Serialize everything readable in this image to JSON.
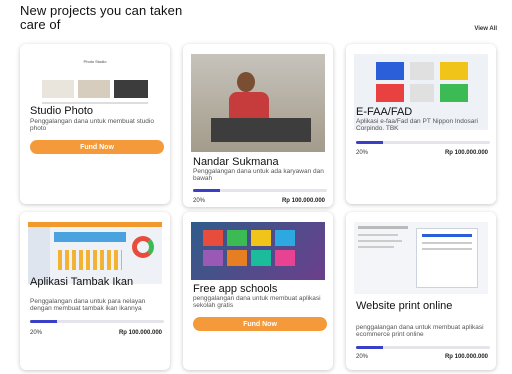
{
  "header": {
    "title": "New projects you can taken care of",
    "view_all": "View All"
  },
  "cards": [
    {
      "title": "Studio Photo",
      "desc": "Penggalangan dana untuk membuat studio photo",
      "button": "Fund Now",
      "thumb_label": "Photo Studio"
    },
    {
      "title": "Nandar Sukmana",
      "desc": "Penggalangan dana untuk ada karyawan dan bawah",
      "progress": 0.2,
      "percent": "20%",
      "amount": "Rp 100.000.000"
    },
    {
      "title": "E-FAA/FAD",
      "desc": "Aplikasi e-faa/Fad dan PT Nippon Indosari Corpindo. TBK",
      "progress": 0.2,
      "percent": "20%",
      "amount": "Rp 100.000.000"
    },
    {
      "title": "Aplikasi Tambak Ikan",
      "desc": "Penggalangan dana untuk para nelayan dengan membuat tambak ikan ikannya",
      "progress": 0.2,
      "percent": "20%",
      "amount": "Rp 100.000.000"
    },
    {
      "title": "Free app schools",
      "desc": "penggalangan dana untuk membuat aplikasi sekolah gratis",
      "button": "Fund Now"
    },
    {
      "title": "Website print online",
      "desc": "penggalangan dana untuk membuat aplikasi ecommerce print online",
      "progress": 0.2,
      "percent": "20%",
      "amount": "Rp 100.000.000"
    }
  ],
  "colors": {
    "accent": "#f59a3a",
    "progress": "#3a3fc7"
  }
}
